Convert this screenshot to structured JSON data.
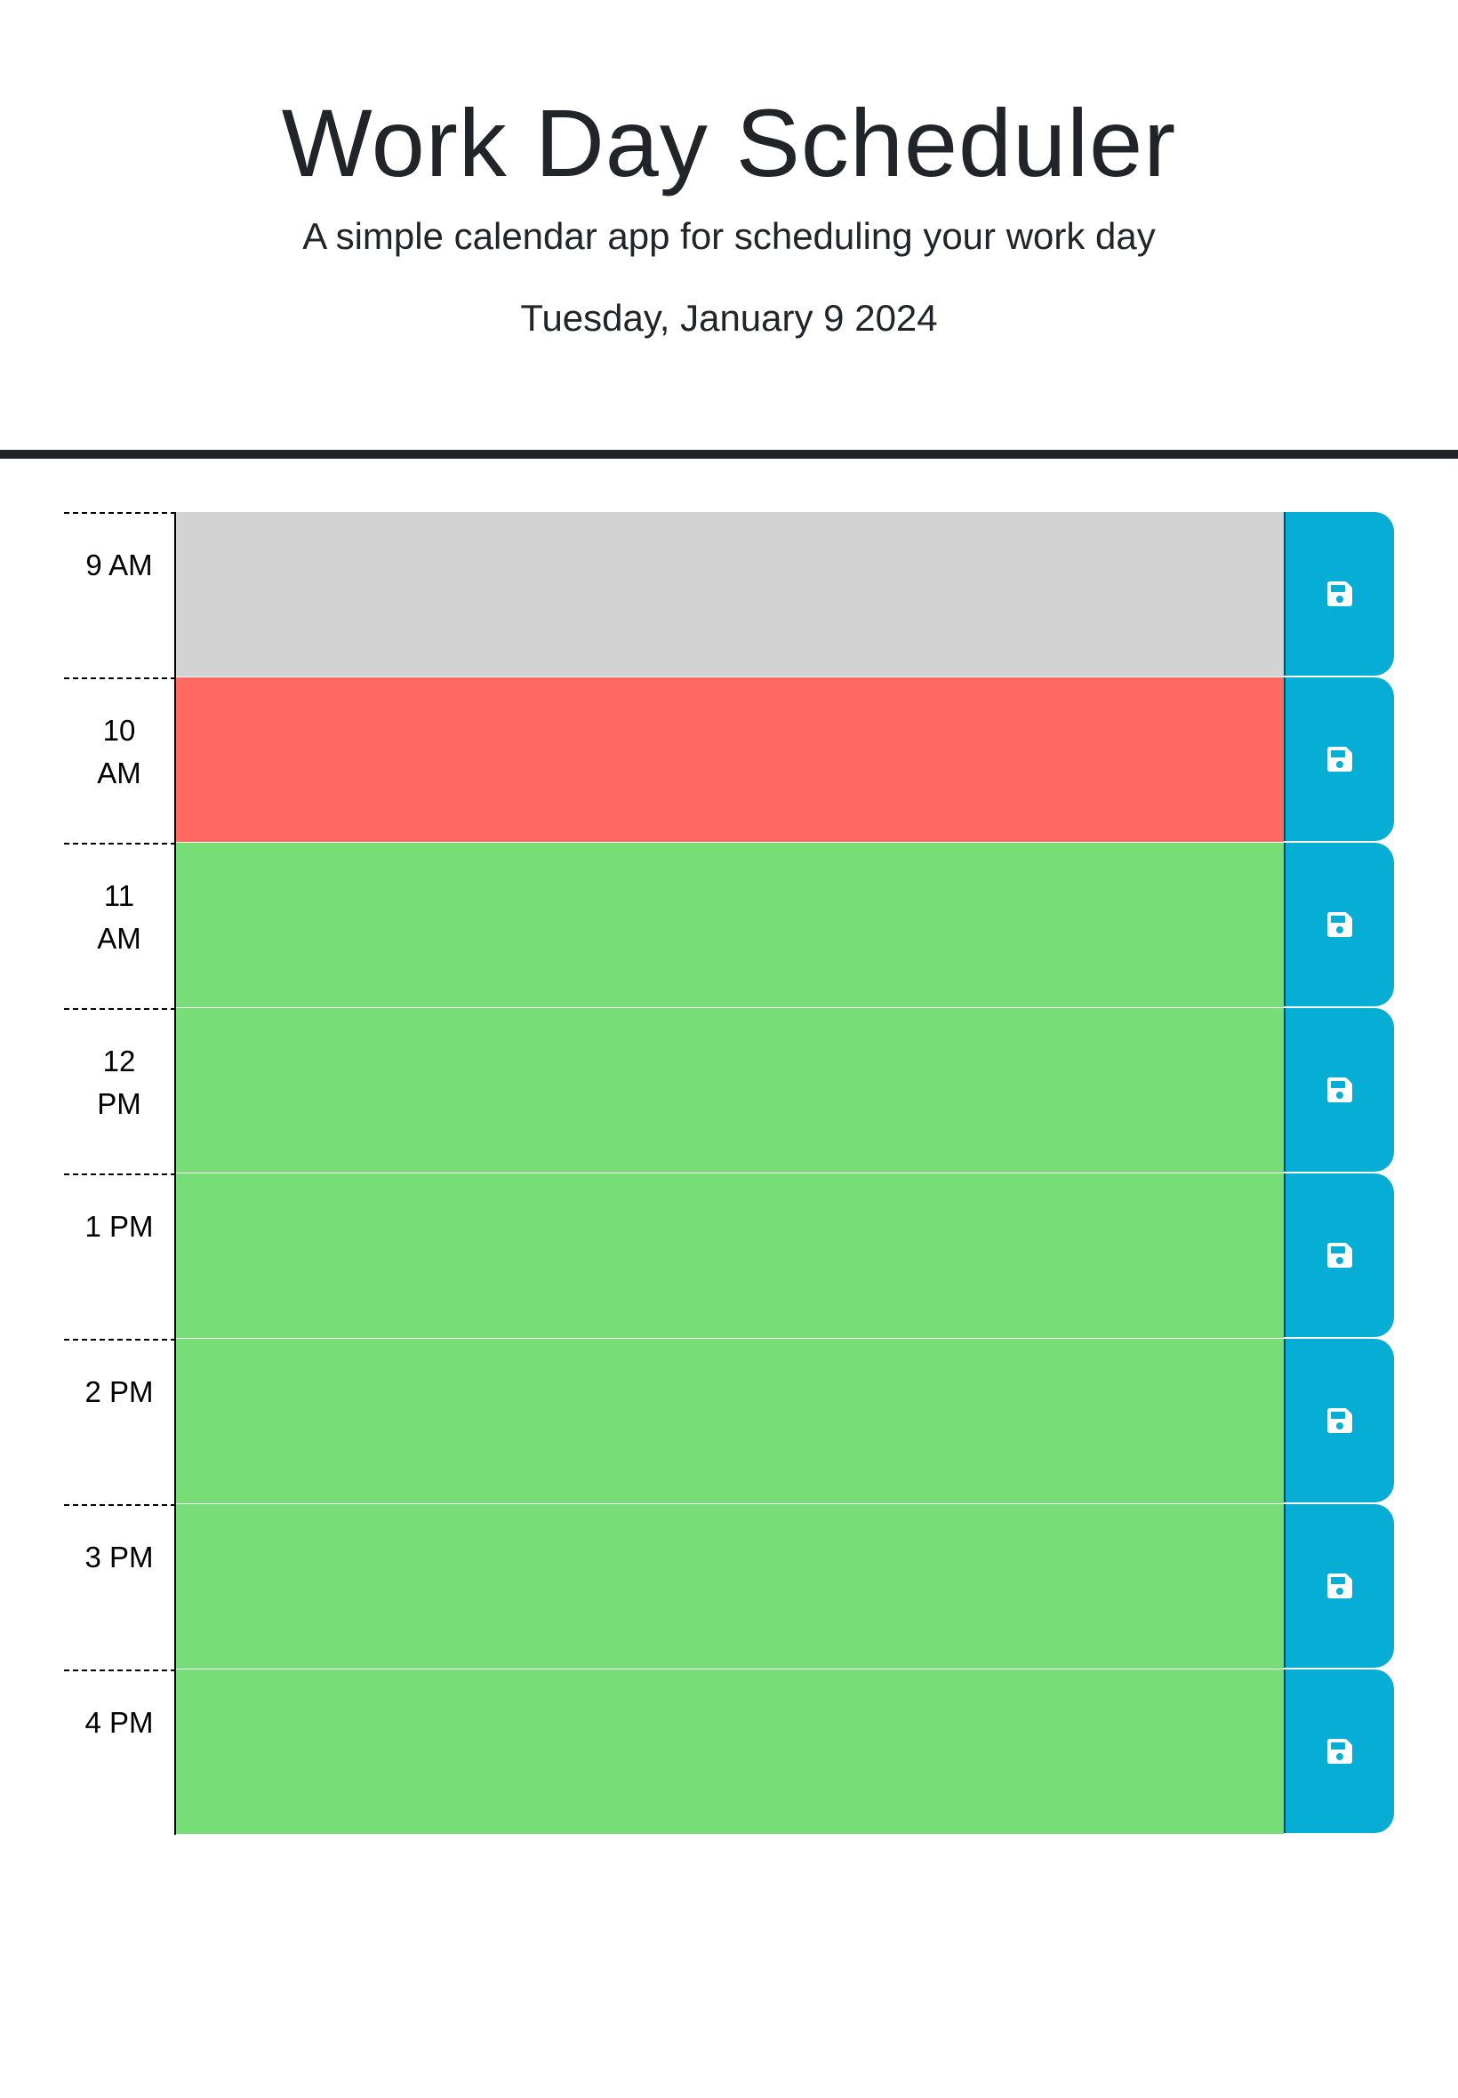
{
  "header": {
    "title": "Work Day Scheduler",
    "subtitle": "A simple calendar app for scheduling your work day",
    "current_date": "Tuesday, January 9 2024"
  },
  "colors": {
    "past": "#d3d3d3",
    "present": "#ff6961",
    "future": "#77dd77",
    "save_button": "#06aed5",
    "save_icon": "#ffffff"
  },
  "save_icon_name": "floppy-disk-icon",
  "schedule": {
    "rows": [
      {
        "hour_label": "9 AM",
        "status": "past",
        "text": ""
      },
      {
        "hour_label": "10 AM",
        "status": "present",
        "text": ""
      },
      {
        "hour_label": "11 AM",
        "status": "future",
        "text": ""
      },
      {
        "hour_label": "12 PM",
        "status": "future",
        "text": ""
      },
      {
        "hour_label": "1 PM",
        "status": "future",
        "text": ""
      },
      {
        "hour_label": "2 PM",
        "status": "future",
        "text": ""
      },
      {
        "hour_label": "3 PM",
        "status": "future",
        "text": ""
      },
      {
        "hour_label": "4 PM",
        "status": "future",
        "text": ""
      }
    ]
  }
}
